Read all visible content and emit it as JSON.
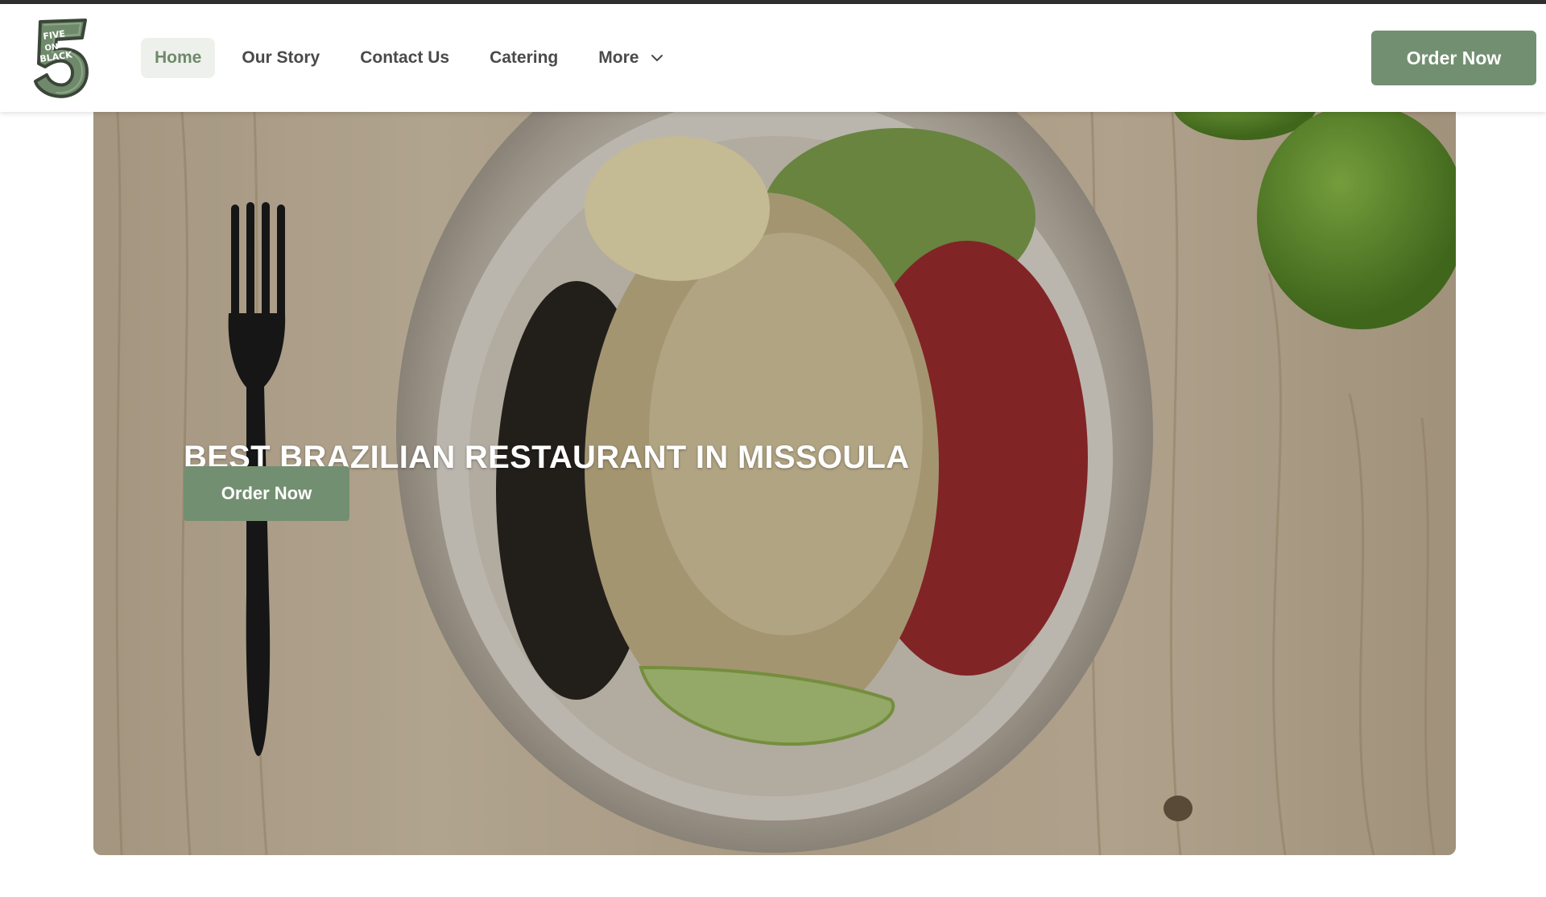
{
  "brand": {
    "logo_text": "FIVE ON BLACK",
    "logo_numeral": "5"
  },
  "nav": {
    "items": [
      {
        "label": "Home",
        "active": true
      },
      {
        "label": "Our Story",
        "active": false
      },
      {
        "label": "Contact Us",
        "active": false
      },
      {
        "label": "Catering",
        "active": false
      },
      {
        "label": "More",
        "active": false,
        "icon": "chevron-down-icon"
      }
    ]
  },
  "header": {
    "order_button_label": "Order Now"
  },
  "hero": {
    "title": "BEST BRAZILIAN RESTAURANT IN MISSOULA",
    "button_label": "Order Now",
    "image_description": "food bowl on wooden table with fork and limes"
  },
  "colors": {
    "accent": "#738f71",
    "nav_active_bg": "#eef0ec",
    "nav_active_text": "#6e8a6a",
    "nav_text": "#4a4a4a",
    "top_strip": "#2f2f2f"
  }
}
